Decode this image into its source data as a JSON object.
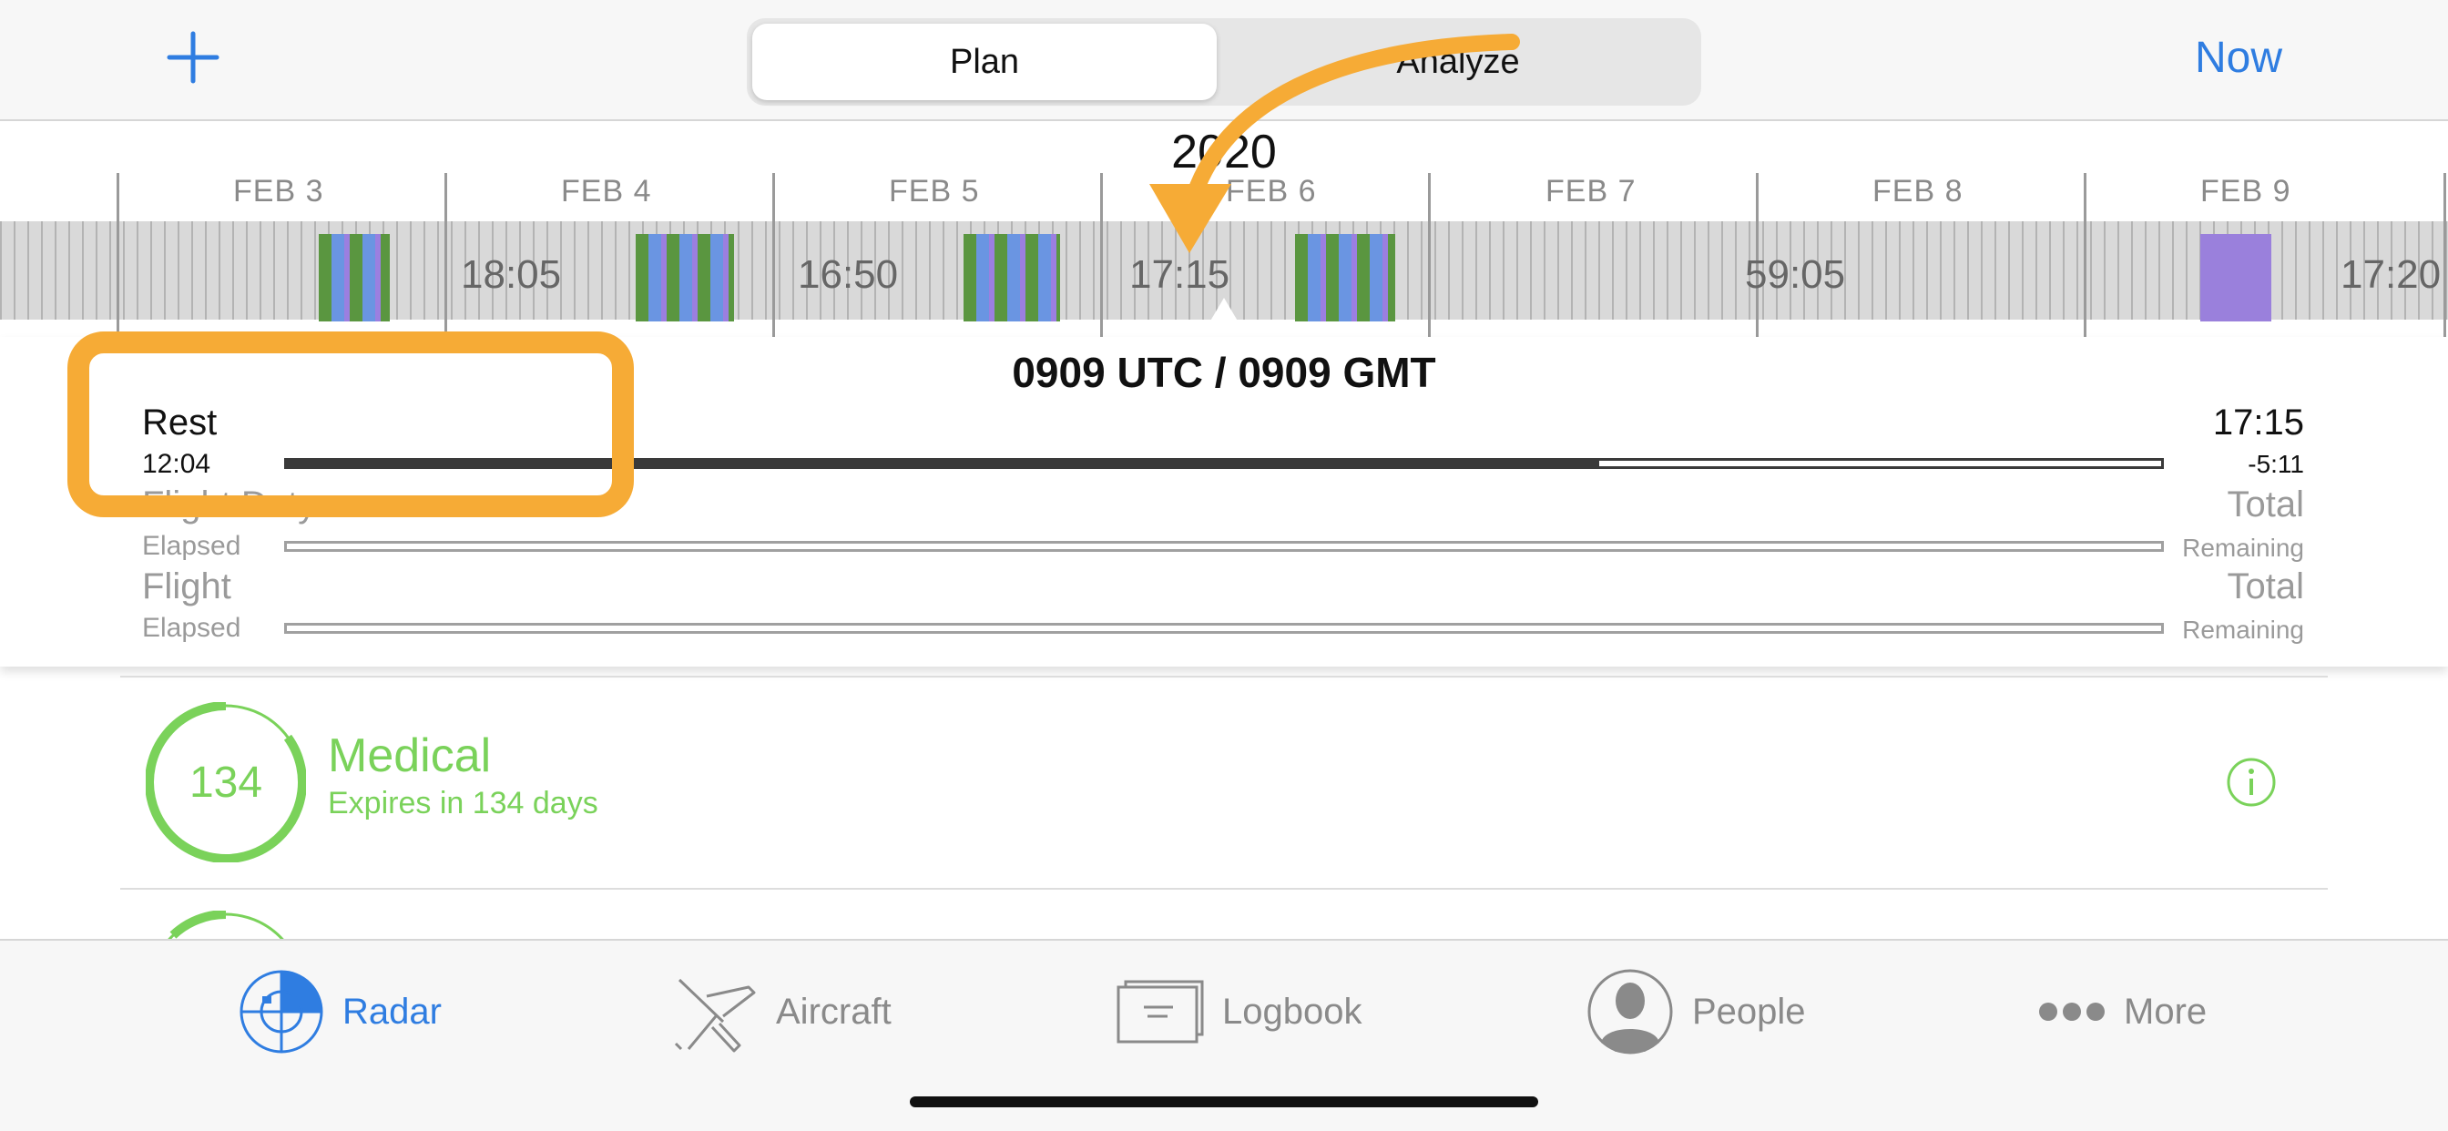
{
  "nav": {
    "segments": {
      "plan": "Plan",
      "analyze": "Analyze"
    },
    "now_label": "Now"
  },
  "timeline": {
    "year": "2020",
    "days": [
      "FEB 3",
      "FEB 4",
      "FEB 5",
      "FEB 6",
      "FEB 7",
      "FEB 8",
      "FEB 9"
    ],
    "rest_values": [
      "18:05",
      "16:50",
      "17:15",
      "59:05",
      "17:20"
    ]
  },
  "status": {
    "time_title": "0909 UTC / 0909 GMT",
    "rest": {
      "name": "Rest",
      "elapsed": "12:04",
      "total": "17:15",
      "remaining": "-5:11",
      "progress": 0.7
    },
    "flight_duty": {
      "name": "Flight Duty",
      "elapsed_label": "Elapsed",
      "total_label": "Total",
      "remaining_label": "Remaining"
    },
    "flight": {
      "name": "Flight",
      "elapsed_label": "Elapsed",
      "total_label": "Total",
      "remaining_label": "Remaining"
    }
  },
  "currency": {
    "medical": {
      "days": "134",
      "title": "Medical",
      "subtitle": "Expires in 134 days",
      "fraction": 0.85
    }
  },
  "tabs": [
    "Radar",
    "Aircraft",
    "Logbook",
    "People",
    "More"
  ],
  "colors": {
    "accent": "#2f7de1",
    "current_green": "#7ad25a",
    "annotation": "#f6ab36",
    "duty_green": "#5a9640",
    "duty_blue": "#6a95e2",
    "duty_purple": "#9b7fe0"
  }
}
